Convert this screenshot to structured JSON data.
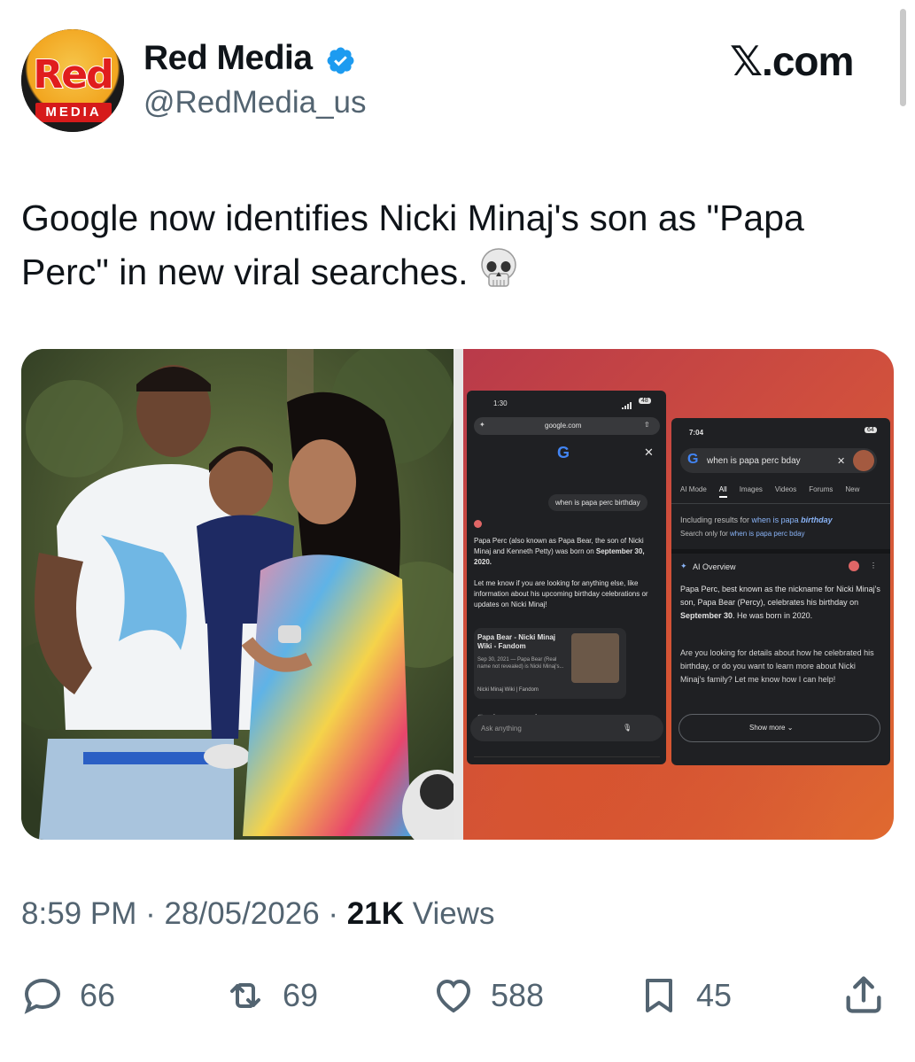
{
  "author": {
    "display_name": "Red Media",
    "handle": "@RedMedia_us",
    "avatar_word": "Red",
    "avatar_tag": "MEDIA",
    "verified_icon": "verified-badge-icon"
  },
  "brand": {
    "label": "𝕏.com"
  },
  "tweet": {
    "text": "Google now identifies Nicki Minaj's son as \"Papa Perc\" in new viral searches.",
    "emoji_icon": "skull-icon"
  },
  "media": {
    "phone1": {
      "time": "1:30",
      "battery": "48",
      "url": "google.com",
      "query": "when is papa perc birthday",
      "answer_1a": "Papa Perc (also known as Papa Bear, the son of Nicki Minaj and Kenneth Petty) was born on ",
      "answer_1b": "September 30, 2020.",
      "answer_2": "Let me know if you are looking for anything else, like information about his upcoming birthday celebrations or updates on Nicki Minaj!",
      "card_title": "Papa Bear - Nicki Minaj Wiki - Fandom",
      "card_date": "Sep 30, 2021 — Papa Bear (Real name not revealed) is Nicki Minaj's...",
      "card_source": "Nicki Minaj Wiki | Fandom",
      "ask_placeholder": "Ask anything"
    },
    "phone2": {
      "time": "7:04",
      "battery": "64",
      "query": "when is papa perc bday",
      "tabs": [
        "AI Mode",
        "All",
        "Images",
        "Videos",
        "Forums",
        "New"
      ],
      "including_prefix": "Including results for ",
      "including_link": "when is papa ",
      "including_bold": "birthday",
      "search_only_prefix": "Search only for ",
      "search_only_link": "when is papa perc bday",
      "ai_title": "AI Overview",
      "ai_p1a": "Papa Perc, best known as the nickname for Nicki Minaj's son, Papa Bear (Percy), celebrates his birthday on ",
      "ai_p1b": "September 30",
      "ai_p1c": ". He was born in 2020.",
      "ai_p2": "Are you looking for details about how he celebrated his birthday, or do you want to learn more about Nicki Minaj's family? Let me know how I can help!",
      "show_more": "Show more"
    }
  },
  "meta": {
    "time": "8:59 PM",
    "separator": "·",
    "date": "28/05/2026",
    "views_count": "21K",
    "views_label": "Views"
  },
  "actions": {
    "replies": "66",
    "reposts": "69",
    "likes": "588",
    "bookmarks": "45"
  },
  "colors": {
    "text": "#0f1419",
    "secondary": "#536471",
    "verified": "#1d9bf0",
    "brand_red": "#d61a1a"
  }
}
